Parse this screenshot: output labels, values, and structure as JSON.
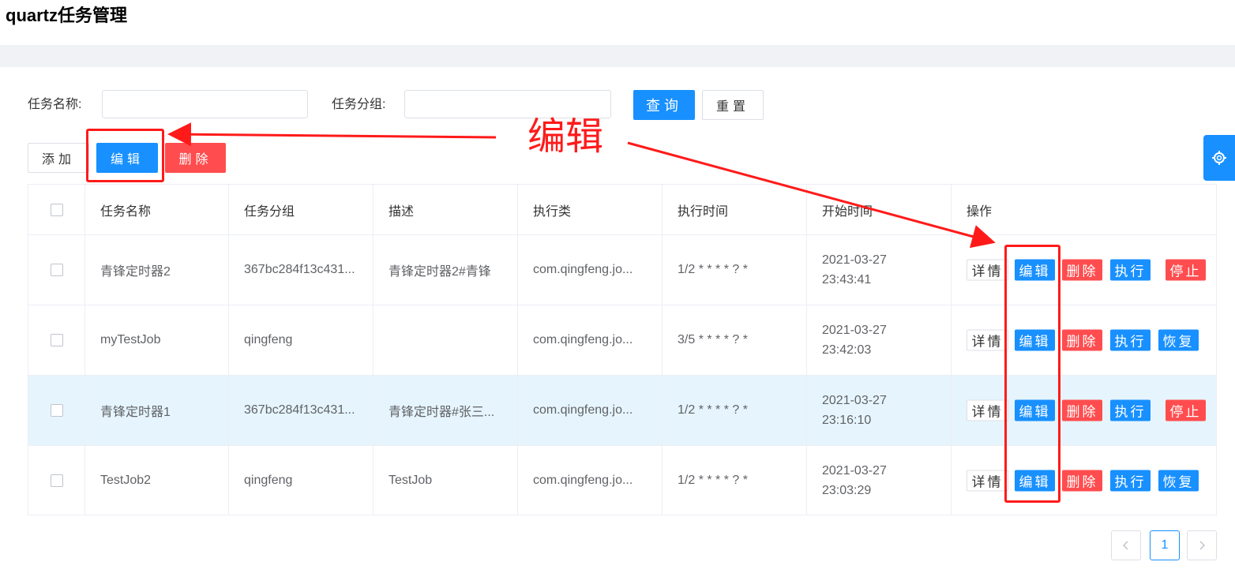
{
  "page": {
    "title": "quartz任务管理"
  },
  "search": {
    "name_label": "任务名称:",
    "name_value": "",
    "group_label": "任务分组:",
    "group_value": "",
    "query_label": "查询",
    "reset_label": "重置"
  },
  "toolbar": {
    "add_label": "添加",
    "edit_label": "编辑",
    "delete_label": "删除"
  },
  "table": {
    "columns": [
      "任务名称",
      "任务分组",
      "描述",
      "执行类",
      "执行时间",
      "开始时间",
      "操作"
    ],
    "rows": [
      {
        "name": "青锋定时器2",
        "group": "367bc284f13c431...",
        "desc": "青锋定时器2#青锋",
        "cls": "com.qingfeng.jo...",
        "cron": "1/2 * * * * ? *",
        "start_date": "2021-03-27",
        "start_time": "23:43:41",
        "toggle": "停止",
        "toggle_state": "running"
      },
      {
        "name": "myTestJob",
        "group": "qingfeng",
        "desc": "",
        "cls": "com.qingfeng.jo...",
        "cron": "3/5 * * * * ? *",
        "start_date": "2021-03-27",
        "start_time": "23:42:03",
        "toggle": "恢复",
        "toggle_state": "paused"
      },
      {
        "name": "青锋定时器1",
        "group": "367bc284f13c431...",
        "desc": "青锋定时器#张三...",
        "cls": "com.qingfeng.jo...",
        "cron": "1/2 * * * * ? *",
        "start_date": "2021-03-27",
        "start_time": "23:16:10",
        "toggle": "停止",
        "toggle_state": "running"
      },
      {
        "name": "TestJob2",
        "group": "qingfeng",
        "desc": "TestJob",
        "cls": "com.qingfeng.jo...",
        "cron": "1/2 * * * * ? *",
        "start_date": "2021-03-27",
        "start_time": "23:03:29",
        "toggle": "恢复",
        "toggle_state": "paused"
      }
    ],
    "actions": {
      "detail": "详情",
      "edit": "编辑",
      "delete": "删除",
      "run": "执行"
    }
  },
  "pagination": {
    "prev_icon": "chevron-left-icon",
    "current_page": "1",
    "next_icon": "chevron-right-icon"
  },
  "annotation": {
    "text": "编辑"
  },
  "colors": {
    "primary": "#1890ff",
    "danger": "#ff4d4f",
    "annotation": "#ff1a1a",
    "highlight_row": "#e6f5fd"
  }
}
